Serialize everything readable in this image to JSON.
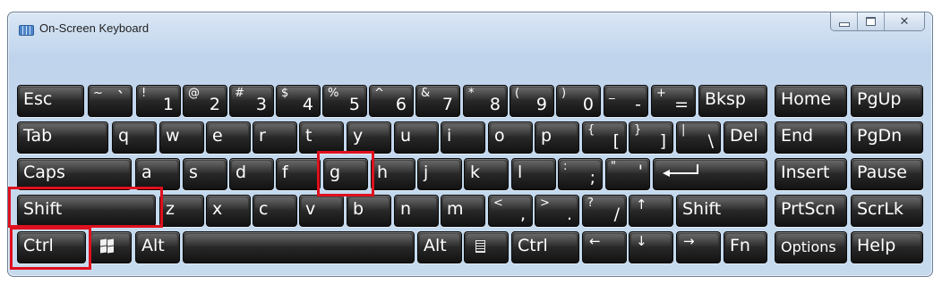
{
  "window": {
    "title": "On-Screen Keyboard",
    "buttons": {
      "minimize": "minimize-icon",
      "maximize": "maximize-icon",
      "close": "close-icon"
    }
  },
  "colors": {
    "key_face": "#1e1e1e",
    "key_text": "#ffffff",
    "window_bg": "#c4d8ee",
    "highlight": "#e0101e"
  },
  "keys": {
    "esc": "Esc",
    "backtick": {
      "shift": "~",
      "base": "`"
    },
    "d1": {
      "shift": "!",
      "base": "1"
    },
    "d2": {
      "shift": "@",
      "base": "2"
    },
    "d3": {
      "shift": "#",
      "base": "3"
    },
    "d4": {
      "shift": "$",
      "base": "4"
    },
    "d5": {
      "shift": "%",
      "base": "5"
    },
    "d6": {
      "shift": "^",
      "base": "6"
    },
    "d7": {
      "shift": "&",
      "base": "7"
    },
    "d8": {
      "shift": "*",
      "base": "8"
    },
    "d9": {
      "shift": "(",
      "base": "9"
    },
    "d0": {
      "shift": ")",
      "base": "0"
    },
    "minus": {
      "shift": "_",
      "base": "-"
    },
    "equals": {
      "shift": "+",
      "base": "="
    },
    "bksp": "Bksp",
    "home": "Home",
    "pgup": "PgUp",
    "tab": "Tab",
    "q": "q",
    "w": "w",
    "e": "e",
    "r": "r",
    "t": "t",
    "y": "y",
    "u": "u",
    "i": "i",
    "o": "o",
    "p": "p",
    "lbracket": {
      "shift": "{",
      "base": "["
    },
    "rbracket": {
      "shift": "}",
      "base": "]"
    },
    "backslash": {
      "shift": "|",
      "base": "\\"
    },
    "del": "Del",
    "end": "End",
    "pgdn": "PgDn",
    "caps": "Caps",
    "a": "a",
    "s": "s",
    "d": "d",
    "f": "f",
    "g": "g",
    "h": "h",
    "j": "j",
    "k": "k",
    "l": "l",
    "semicolon": {
      "shift": ":",
      "base": ";"
    },
    "quote": {
      "shift": "\"",
      "base": "'"
    },
    "enter": "enter-arrow-icon",
    "insert": "Insert",
    "pause": "Pause",
    "shift_left": "Shift",
    "z": "z",
    "x": "x",
    "c": "c",
    "v": "v",
    "b": "b",
    "n": "n",
    "m": "m",
    "comma": {
      "shift": "<",
      "base": ","
    },
    "period": {
      "shift": ">",
      "base": "."
    },
    "slash": {
      "shift": "?",
      "base": "/"
    },
    "arrow_up": "↑",
    "shift_right": "Shift",
    "prtscn": "PrtScn",
    "scrlk": "ScrLk",
    "ctrl_left": "Ctrl",
    "windows": "windows-logo-icon",
    "alt_left": "Alt",
    "space": "",
    "alt_right": "Alt",
    "menu": "context-menu-icon",
    "ctrl_right": "Ctrl",
    "arrow_left": "←",
    "arrow_down": "↓",
    "arrow_right": "→",
    "fn": "Fn",
    "options": "Options",
    "help": "Help"
  },
  "highlighted_keys": [
    "g",
    "shift_left",
    "ctrl_left"
  ]
}
